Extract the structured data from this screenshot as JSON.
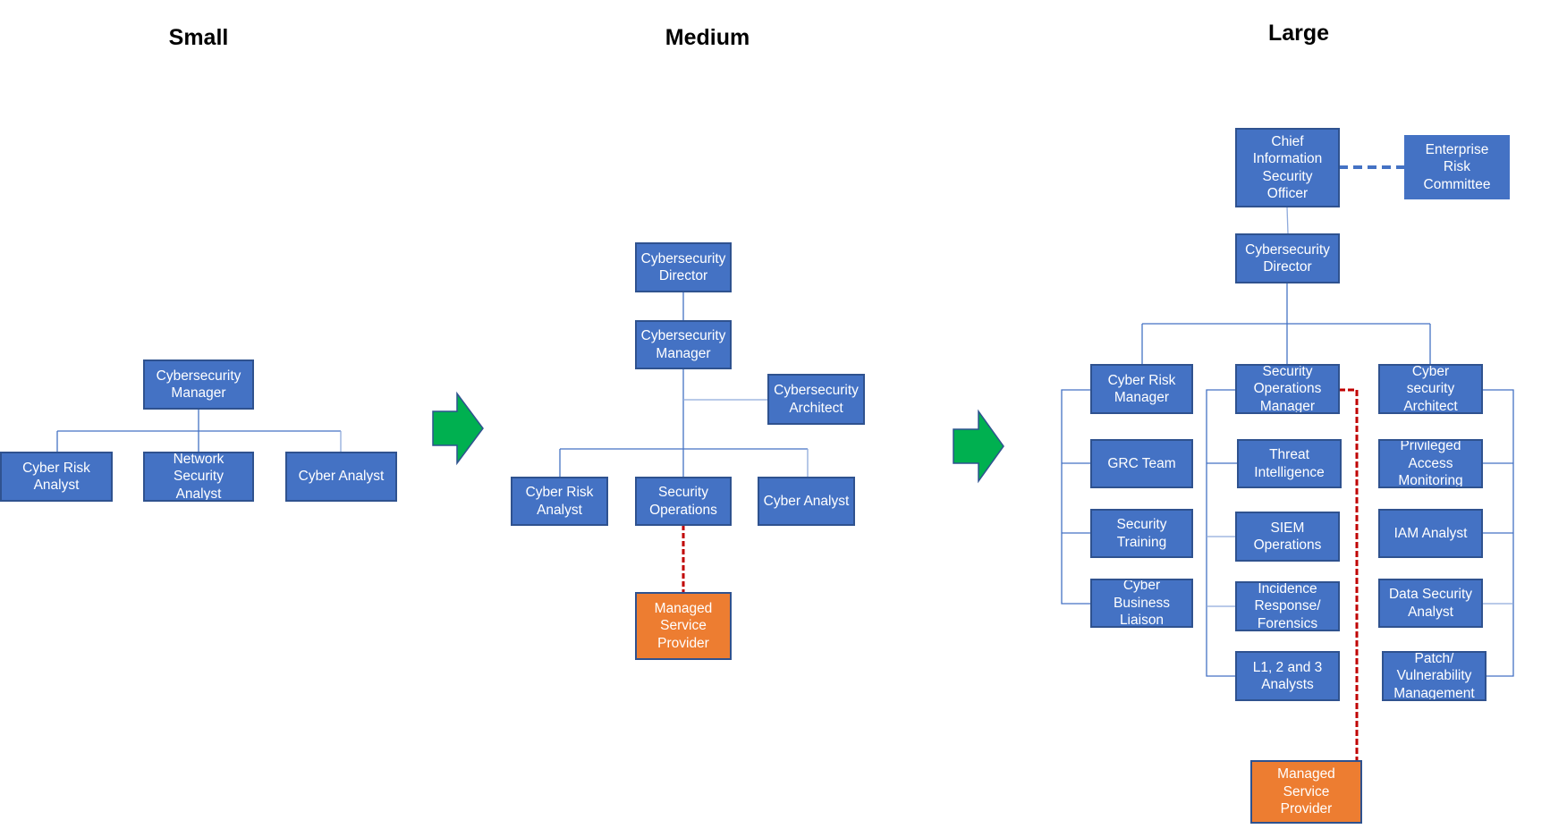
{
  "titles": {
    "small": "Small",
    "medium": "Medium",
    "large": "Large"
  },
  "colors": {
    "box_fill": "#4472c4",
    "box_border": "#2f528f",
    "msp_fill": "#ed7d31",
    "connector": "#4472c4",
    "dotted_link": "#c00000",
    "arrow_fill": "#00b050"
  },
  "small": {
    "manager": "Cybersecurity\nManager",
    "cyber_risk_analyst": "Cyber Risk\nAnalyst",
    "network_security_analyst": "Network\nSecurity\nAnalyst",
    "cyber_analyst": "Cyber Analyst"
  },
  "medium": {
    "director": "Cybersecurity\nDirector",
    "manager": "Cybersecurity\nManager",
    "architect": "Cybersecurity\nArchitect",
    "cyber_risk_analyst": "Cyber Risk\nAnalyst",
    "security_operations": "Security\nOperations",
    "cyber_analyst": "Cyber Analyst",
    "msp": "Managed\nService\nProvider"
  },
  "large": {
    "ciso": "Chief\nInformation\nSecurity\nOfficer",
    "erc": "Enterprise\nRisk\nCommittee",
    "director": "Cybersecurity\nDirector",
    "cyber_risk_manager": "Cyber Risk\nManager",
    "soc_manager": "Security\nOperations\nManager",
    "architect": "Cyber\nsecurity\nArchitect",
    "grc_team": "GRC Team",
    "security_training": "Security\nTraining",
    "business_liaison": "Cyber\nBusiness\nLiaison",
    "threat_intel": "Threat\nIntelligence",
    "siem_ops": "SIEM\nOperations",
    "incident_response": "Incidence\nResponse/\nForensics",
    "analysts_l123": "L1, 2 and 3\nAnalysts",
    "pam": "Privileged\nAccess\nMonitoring",
    "iam_analyst": "IAM Analyst",
    "data_security_analyst": "Data Security\nAnalyst",
    "patch_vuln": "Patch/\nVulnerability\nManagement",
    "msp": "Managed\nService\nProvider"
  }
}
